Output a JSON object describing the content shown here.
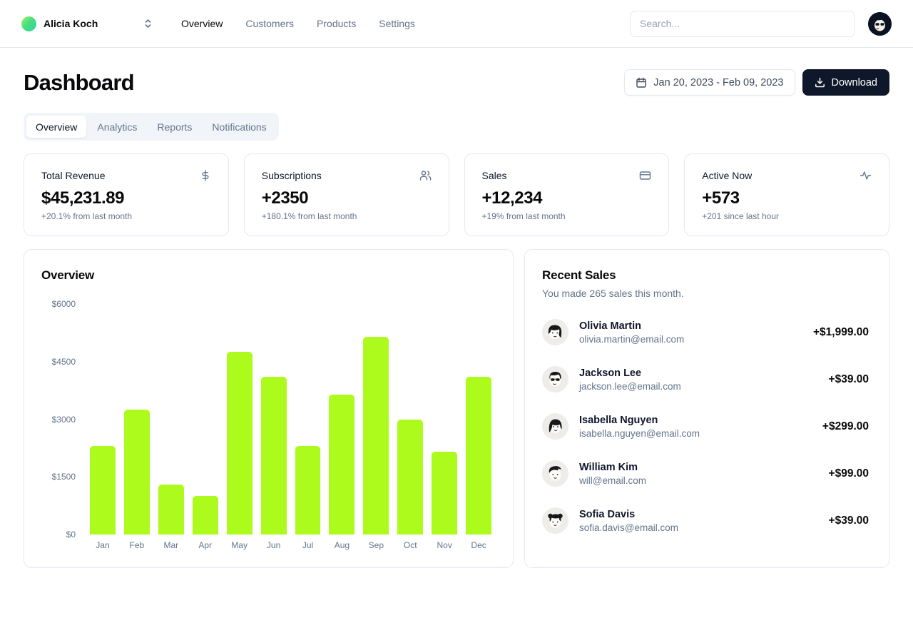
{
  "header": {
    "team_name": "Alicia Koch",
    "nav": [
      {
        "label": "Overview",
        "active": true
      },
      {
        "label": "Customers",
        "active": false
      },
      {
        "label": "Products",
        "active": false
      },
      {
        "label": "Settings",
        "active": false
      }
    ],
    "search_placeholder": "Search..."
  },
  "page": {
    "title": "Dashboard",
    "date_range": "Jan 20, 2023 - Feb 09, 2023",
    "download_label": "Download",
    "tabs": [
      {
        "label": "Overview",
        "active": true
      },
      {
        "label": "Analytics",
        "active": false
      },
      {
        "label": "Reports",
        "active": false
      },
      {
        "label": "Notifications",
        "active": false
      }
    ]
  },
  "stats": [
    {
      "title": "Total Revenue",
      "icon": "dollar-sign-icon",
      "value": "$45,231.89",
      "change": "+20.1% from last month"
    },
    {
      "title": "Subscriptions",
      "icon": "users-icon",
      "value": "+2350",
      "change": "+180.1% from last month"
    },
    {
      "title": "Sales",
      "icon": "credit-card-icon",
      "value": "+12,234",
      "change": "+19% from last month"
    },
    {
      "title": "Active Now",
      "icon": "activity-icon",
      "value": "+573",
      "change": "+201 since last hour"
    }
  ],
  "chart_data": {
    "type": "bar",
    "title": "Overview",
    "categories": [
      "Jan",
      "Feb",
      "Mar",
      "Apr",
      "May",
      "Jun",
      "Jul",
      "Aug",
      "Sep",
      "Oct",
      "Nov",
      "Dec"
    ],
    "values": [
      2300,
      3250,
      1300,
      1000,
      4750,
      4100,
      2300,
      3650,
      5150,
      3000,
      2150,
      4100
    ],
    "xlabel": "",
    "ylabel": "",
    "ylim": [
      0,
      6000
    ],
    "yticks": [
      "$6000",
      "$4500",
      "$3000",
      "$1500",
      "$0"
    ],
    "bar_color": "#adfa1d",
    "grid": false,
    "legend": "none"
  },
  "recent_sales": {
    "title": "Recent Sales",
    "subtitle": "You made 265 sales this month.",
    "items": [
      {
        "name": "Olivia Martin",
        "email": "olivia.martin@email.com",
        "amount": "+$1,999.00"
      },
      {
        "name": "Jackson Lee",
        "email": "jackson.lee@email.com",
        "amount": "+$39.00"
      },
      {
        "name": "Isabella Nguyen",
        "email": "isabella.nguyen@email.com",
        "amount": "+$299.00"
      },
      {
        "name": "William Kim",
        "email": "will@email.com",
        "amount": "+$99.00"
      },
      {
        "name": "Sofia Davis",
        "email": "sofia.davis@email.com",
        "amount": "+$39.00"
      }
    ]
  },
  "colors": {
    "accent": "#adfa1d",
    "primary_dark": "#0f172a",
    "muted_text": "#64748b",
    "border": "#e2e8f0",
    "tabs_bg": "#f1f5f9"
  }
}
